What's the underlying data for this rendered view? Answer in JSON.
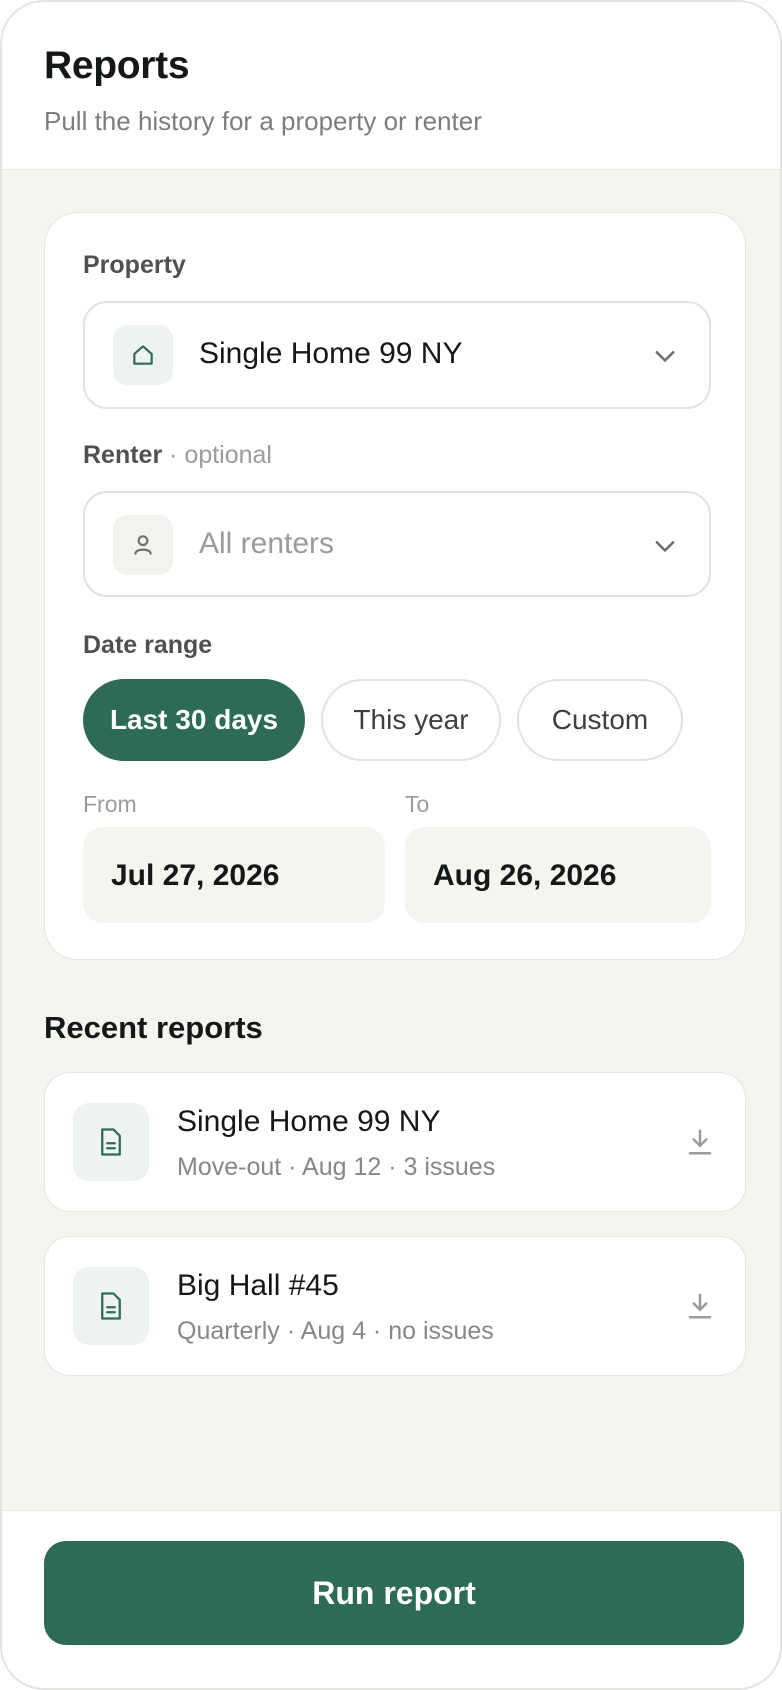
{
  "header": {
    "title": "Reports",
    "subtitle": "Pull the history for a property or renter"
  },
  "form": {
    "property_label": "Property",
    "property_value": "Single Home 99 NY",
    "renter_label": "Renter",
    "renter_optional": "· optional",
    "renter_placeholder": "All renters",
    "date_range_label": "Date range",
    "date_range_options": [
      "Last 30 days",
      "This year",
      "Custom"
    ],
    "date_range_selected": "Last 30 days",
    "from_label": "From",
    "from_value": "Jul 27, 2026",
    "to_label": "To",
    "to_value": "Aug 26, 2026"
  },
  "recent": {
    "title": "Recent reports",
    "items": [
      {
        "name": "Single Home 99 NY",
        "meta": "Move-out · Aug 12 · 3 issues"
      },
      {
        "name": "Big Hall #45",
        "meta": "Quarterly · Aug 4 · no issues"
      }
    ]
  },
  "footer": {
    "run_label": "Run report"
  },
  "colors": {
    "accent": "#2e6b54",
    "background": "#f4f4f0",
    "card": "#ffffff"
  },
  "icons": {
    "property": "home-icon",
    "renter": "user-icon",
    "dropdown": "chevron-down-icon",
    "report": "document-icon",
    "download": "download-icon"
  }
}
